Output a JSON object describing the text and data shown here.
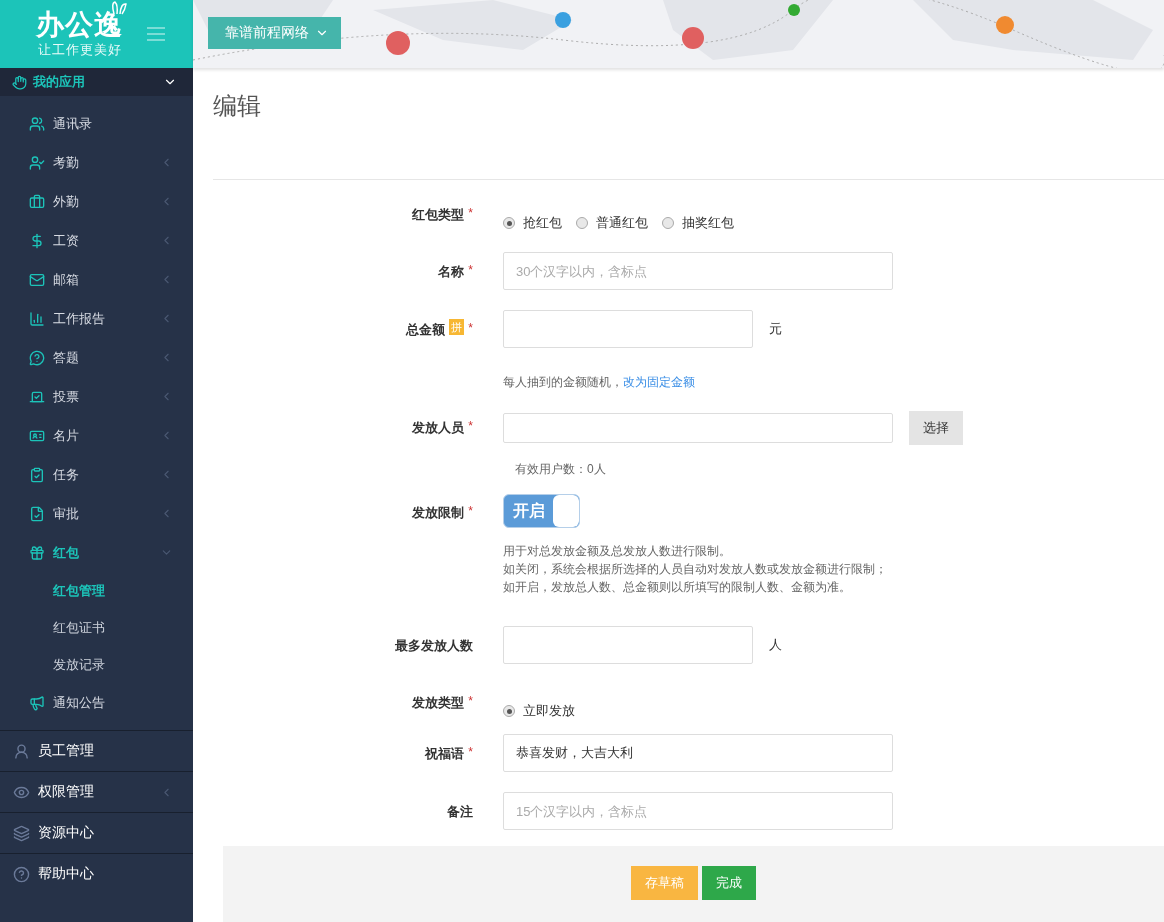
{
  "logo": {
    "name": "办公逸",
    "slogan": "让工作更美好"
  },
  "company_menu": {
    "label": "靠谱前程网络"
  },
  "sidebar": {
    "group": {
      "label": "我的应用",
      "expanded": true
    },
    "items": [
      {
        "label": "通讯录",
        "expandable": false,
        "active": false
      },
      {
        "label": "考勤",
        "expandable": true,
        "expanded": false,
        "active": false
      },
      {
        "label": "外勤",
        "expandable": true,
        "expanded": false,
        "active": false
      },
      {
        "label": "工资",
        "expandable": true,
        "expanded": false,
        "active": false
      },
      {
        "label": "邮箱",
        "expandable": true,
        "expanded": false,
        "active": false
      },
      {
        "label": "工作报告",
        "expandable": true,
        "expanded": false,
        "active": false
      },
      {
        "label": "答题",
        "expandable": true,
        "expanded": false,
        "active": false
      },
      {
        "label": "投票",
        "expandable": true,
        "expanded": false,
        "active": false
      },
      {
        "label": "名片",
        "expandable": true,
        "expanded": false,
        "active": false
      },
      {
        "label": "任务",
        "expandable": true,
        "expanded": false,
        "active": false
      },
      {
        "label": "审批",
        "expandable": true,
        "expanded": false,
        "active": false
      },
      {
        "label": "红包",
        "expandable": true,
        "expanded": true,
        "active": true,
        "children": [
          {
            "label": "红包管理",
            "selected": true
          },
          {
            "label": "红包证书",
            "selected": false
          },
          {
            "label": "发放记录",
            "selected": false
          }
        ]
      },
      {
        "label": "通知公告",
        "expandable": false,
        "active": false
      }
    ],
    "sections": [
      {
        "label": "员工管理",
        "expandable": false
      },
      {
        "label": "权限管理",
        "expandable": true
      },
      {
        "label": "资源中心",
        "expandable": false
      },
      {
        "label": "帮助中心",
        "expandable": false
      }
    ]
  },
  "page": {
    "title": "编辑"
  },
  "form": {
    "rows": [
      {
        "kind": "radio",
        "label": "红包类型",
        "required_mark": "*",
        "options": [
          {
            "label": "抢红包",
            "selected": true
          },
          {
            "label": "普通红包",
            "selected": false
          },
          {
            "label": "抽奖红包",
            "selected": false
          }
        ]
      },
      {
        "kind": "text",
        "label": "名称",
        "required_mark": "*",
        "placeholder": "30个汉字以内，含标点"
      },
      {
        "kind": "unit",
        "label": "总金额",
        "badge": "拼",
        "required_mark": "*",
        "unit": "元",
        "hint": "每人抽到的金额随机，",
        "link": "改为固定金额"
      },
      {
        "kind": "picker",
        "label": "发放人员",
        "required_mark": "*",
        "button": "选择",
        "note": "有效用户数：0人"
      },
      {
        "kind": "toggle",
        "label": "发放限制",
        "required_mark": "*",
        "on": true,
        "toggle_label": "开启",
        "notes": [
          "用于对总发放金额及总发放人数进行限制。",
          "如关闭，系统会根据所选择的人员自动对发放人数或发放金额进行限制；",
          "如开启，发放总人数、总金额则以所填写的限制人数、金额为准。"
        ]
      },
      {
        "kind": "unit",
        "label": "最多发放人数",
        "unit": "人"
      },
      {
        "kind": "radio",
        "label": "发放类型",
        "required_mark": "*",
        "options": [
          {
            "label": "立即发放",
            "selected": true
          }
        ]
      },
      {
        "kind": "text",
        "label": "祝福语",
        "required_mark": "*",
        "value": "恭喜发财，大吉大利"
      },
      {
        "kind": "text",
        "label": "备注",
        "placeholder": "15个汉字以内，含标点"
      }
    ]
  },
  "footer": {
    "buttons": [
      {
        "label": "存草稿",
        "kind": "draft"
      },
      {
        "label": "完成",
        "kind": "primary"
      }
    ]
  }
}
